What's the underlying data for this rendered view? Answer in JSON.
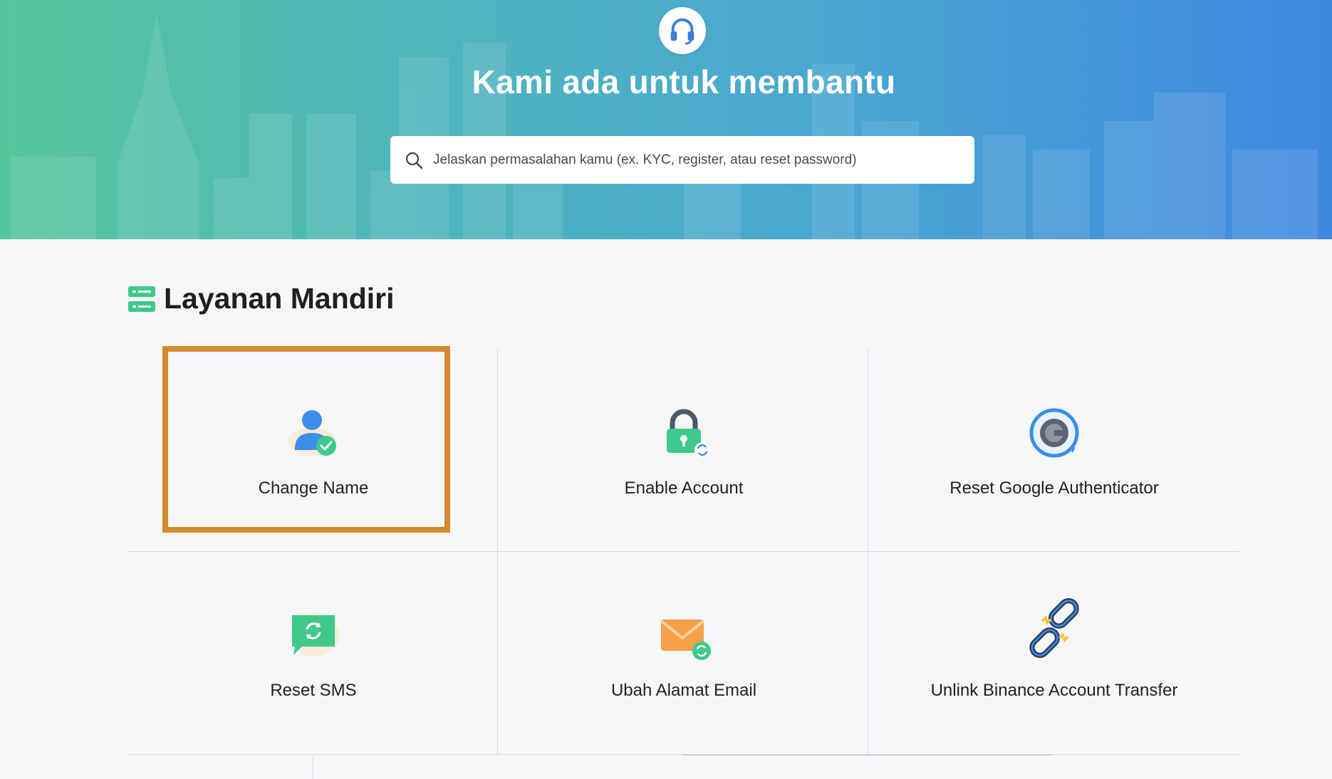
{
  "hero": {
    "title": "Kami ada untuk membantu",
    "search_placeholder": "Jelaskan permasalahan kamu (ex. KYC, register, atau reset password)",
    "badge_icon": "headset-icon"
  },
  "section": {
    "title": "Layanan Mandiri",
    "icon": "service-list-icon"
  },
  "services": [
    {
      "label": "Change Name",
      "icon": "user-check-icon"
    },
    {
      "label": "Enable Account",
      "icon": "padlock-refresh-icon"
    },
    {
      "label": "Reset Google Authenticator",
      "icon": "authenticator-icon"
    },
    {
      "label": "Reset SMS",
      "icon": "sms-refresh-icon"
    },
    {
      "label": "Ubah Alamat Email",
      "icon": "email-refresh-icon"
    },
    {
      "label": "Unlink Binance Account Transfer",
      "icon": "broken-link-icon"
    }
  ],
  "colors": {
    "highlight_border": "#d38b2c",
    "accent_green": "#3fc98a",
    "hero_gradient_start": "#55c79c",
    "hero_gradient_end": "#3f88e0"
  }
}
